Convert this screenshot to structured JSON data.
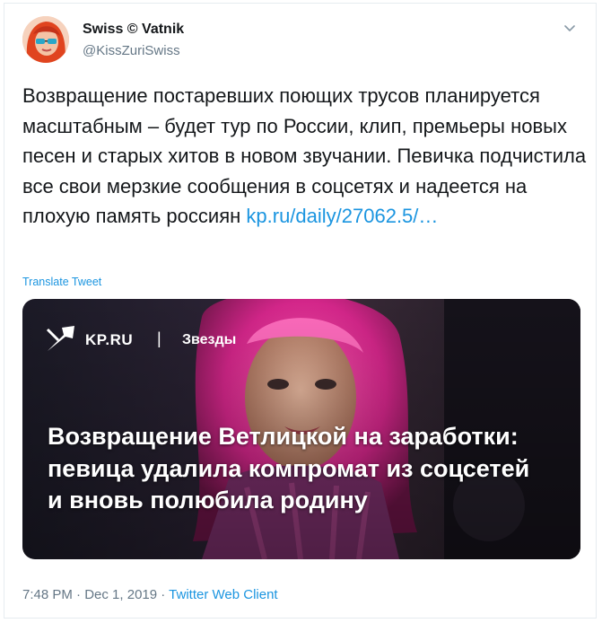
{
  "author": {
    "name": "Swiss © Vatnik",
    "handle": "@KissZuriSwiss"
  },
  "tweet": {
    "text": "Возвращение постаревших поющих трусов планируется масштабным – будет тур по России, клип, премьеры новых песен и старых хитов в новом звучании. Певичка подчистила все свои мерзкие сообщения в соцсетях и надеется на плохую память россиян",
    "link": "kp.ru/daily/27062.5/…",
    "translate_label": "Translate Tweet"
  },
  "media": {
    "site": "KP.RU",
    "separator": "|",
    "section": "Звезды",
    "headline": "Возвращение Ветлицкой на заработки: певица удалила компромат из соцсетей и вновь полюбила родину"
  },
  "meta": {
    "time": "7:48 PM",
    "dot": " · ",
    "date": "Dec 1, 2019",
    "dot2": " · ",
    "client": "Twitter Web Client"
  },
  "icons": {
    "menu": "chevron-down-icon",
    "brand": "kp-bird-logo"
  },
  "colors": {
    "link": "#1b95e0",
    "secondary_text": "#657786",
    "primary_text": "#14171a"
  }
}
